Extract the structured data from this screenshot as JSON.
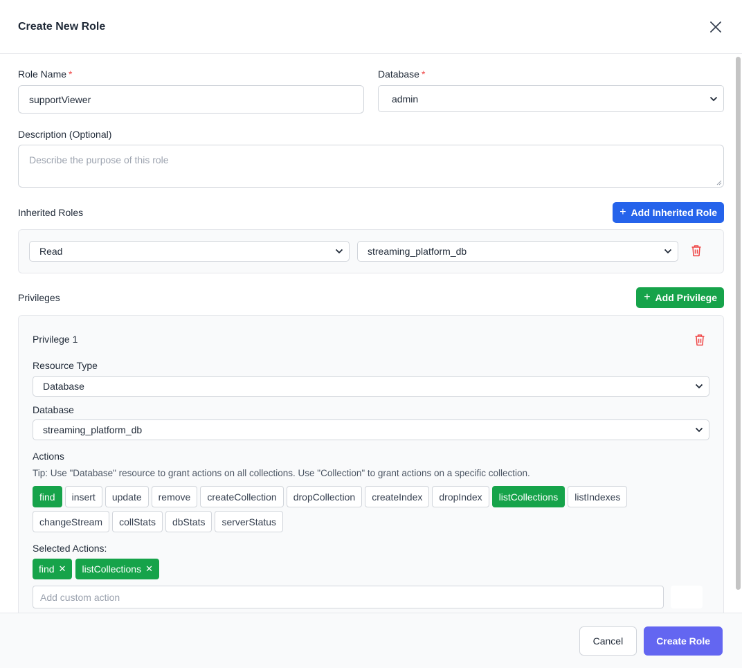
{
  "modal": {
    "title": "Create New Role"
  },
  "form": {
    "role_name_label": "Role Name",
    "required_mark": "*",
    "role_name_value": "supportViewer",
    "database_label": "Database",
    "database_value": "admin",
    "description_label": "Description (Optional)",
    "description_placeholder": "Describe the purpose of this role"
  },
  "inherited_roles": {
    "label": "Inherited Roles",
    "add_button": "Add Inherited Role",
    "items": [
      {
        "role": "Read",
        "database": "streaming_platform_db"
      }
    ]
  },
  "privileges": {
    "label": "Privileges",
    "add_button": "Add Privilege",
    "items": [
      {
        "title": "Privilege 1",
        "resource_type_label": "Resource Type",
        "resource_type_value": "Database",
        "database_label": "Database",
        "database_value": "streaming_platform_db",
        "actions_label": "Actions",
        "tip": "Tip: Use \"Database\" resource to grant actions on all collections. Use \"Collection\" to grant actions on a specific collection.",
        "actions": [
          {
            "name": "find",
            "selected": true
          },
          {
            "name": "insert",
            "selected": false
          },
          {
            "name": "update",
            "selected": false
          },
          {
            "name": "remove",
            "selected": false
          },
          {
            "name": "createCollection",
            "selected": false
          },
          {
            "name": "dropCollection",
            "selected": false
          },
          {
            "name": "createIndex",
            "selected": false
          },
          {
            "name": "dropIndex",
            "selected": false
          },
          {
            "name": "listCollections",
            "selected": true
          },
          {
            "name": "listIndexes",
            "selected": false
          },
          {
            "name": "changeStream",
            "selected": false
          },
          {
            "name": "collStats",
            "selected": false
          },
          {
            "name": "dbStats",
            "selected": false
          },
          {
            "name": "serverStatus",
            "selected": false
          }
        ],
        "selected_actions_label": "Selected Actions:",
        "selected_actions": [
          "find",
          "listCollections"
        ],
        "custom_action_placeholder": "Add custom action"
      }
    ]
  },
  "footer": {
    "cancel": "Cancel",
    "create": "Create Role"
  },
  "icons": {
    "close": "close-icon",
    "trash": "trash-icon",
    "plus": "plus-icon",
    "chevron": "chevron-down-icon",
    "remove": "remove-x-icon"
  },
  "colors": {
    "primary_blue": "#2563eb",
    "green": "#16a34a",
    "indigo": "#6366f1",
    "danger": "#ef4444"
  }
}
